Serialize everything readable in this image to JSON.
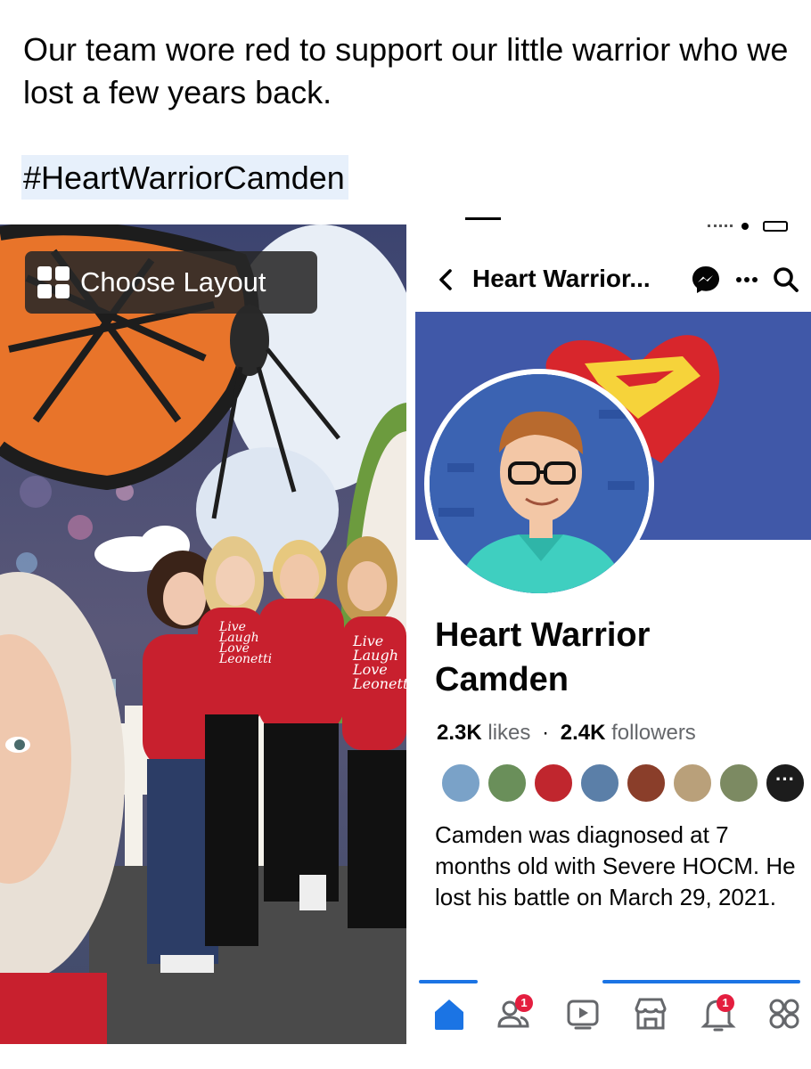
{
  "post": {
    "caption": "Our team wore red to support our little warrior who we lost a few years back.",
    "hashtag": "#HeartWarriorCamden"
  },
  "photo": {
    "choose_layout_label": "Choose Layout",
    "icon": "layout-grid-icon",
    "shirt_text": [
      "Live",
      "Laugh",
      "Love",
      "Leonetti"
    ]
  },
  "phone": {
    "nav": {
      "title": "Heart Warrior...",
      "icons": [
        "back-chevron-icon",
        "messenger-icon",
        "more-icon",
        "search-icon"
      ]
    },
    "page": {
      "name": "Heart Warrior Camden",
      "likes_count": "2.3K",
      "likes_label": "likes",
      "separator": "·",
      "followers_count": "2.4K",
      "followers_label": "followers",
      "more_friends": "···",
      "about": "Camden was diagnosed at 7 months old with Severe HOCM. He lost his battle on March 29, 2021."
    },
    "tabbar": {
      "tabs": [
        {
          "icon": "home-icon",
          "badge": ""
        },
        {
          "icon": "friends-icon",
          "badge": "1"
        },
        {
          "icon": "video-icon",
          "badge": ""
        },
        {
          "icon": "marketplace-icon",
          "badge": ""
        },
        {
          "icon": "bell-icon",
          "badge": "1"
        },
        {
          "icon": "menu-icon",
          "badge": ""
        }
      ]
    },
    "colors": {
      "accent": "#1b74e4",
      "cover_bg": "#4058a8",
      "badge": "#e41e3f",
      "shirt_red": "#c8202e"
    }
  }
}
